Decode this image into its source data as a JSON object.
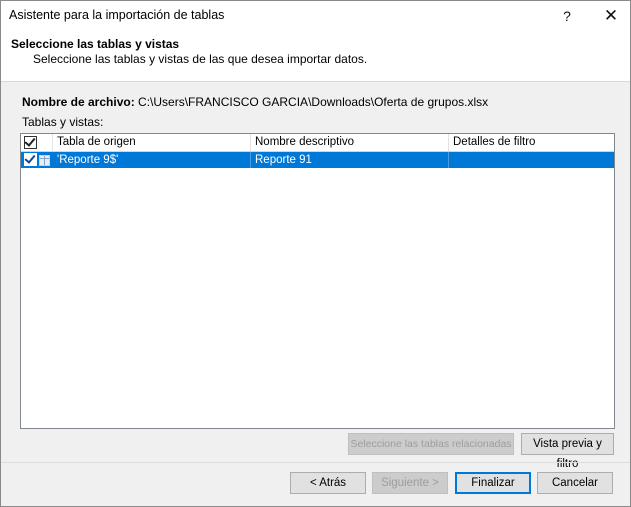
{
  "window": {
    "title": "Asistente para la importación de tablas",
    "help": "?",
    "close": "✕"
  },
  "header": {
    "title": "Seleccione las tablas y vistas",
    "subtitle": "Seleccione las tablas y vistas de las que desea importar datos."
  },
  "file": {
    "label": "Nombre de archivo:",
    "path": "C:\\Users\\FRANCISCO GARCIA\\Downloads\\Oferta de grupos.xlsx"
  },
  "tables_label": "Tablas y vistas:",
  "grid": {
    "columns": [
      "Tabla de origen",
      "Nombre descriptivo",
      "Detalles de filtro"
    ],
    "header_checked": true,
    "rows": [
      {
        "checked": true,
        "selected": true,
        "source": "'Reporte 9$'",
        "name": "Reporte 91",
        "filter": ""
      }
    ]
  },
  "buttons": {
    "related": "Seleccione las tablas relacionadas",
    "preview": "Vista previa y filtro",
    "back": "< Atrás",
    "next": "Siguiente >",
    "finish": "Finalizar",
    "cancel": "Cancelar"
  },
  "colors": {
    "selection": "#0078d7",
    "button_face": "#e1e1e1",
    "dialog_bg": "#f0f0f0"
  }
}
